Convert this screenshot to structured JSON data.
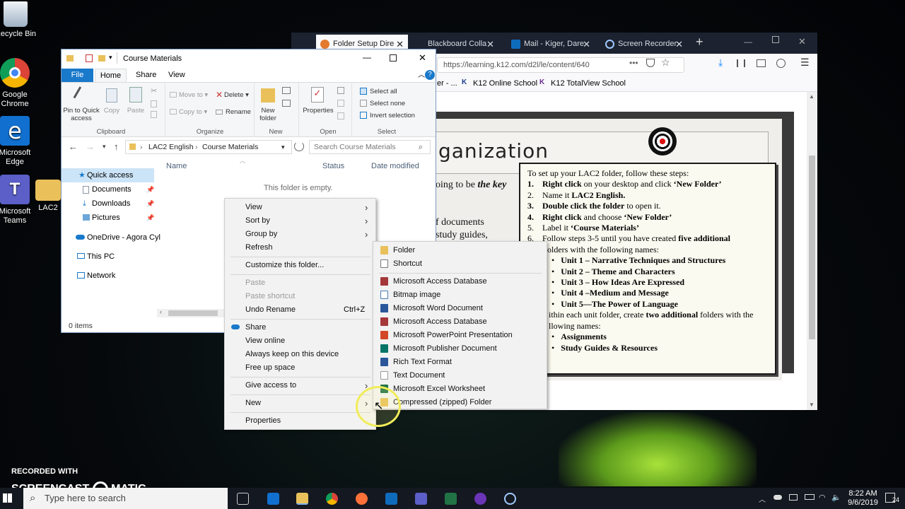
{
  "desktop": {
    "icons": [
      {
        "label": "Recycle Bin"
      },
      {
        "label": "Google Chrome"
      },
      {
        "label": "Microsoft Edge"
      },
      {
        "label": "Microsoft Teams"
      },
      {
        "label": "LAC2"
      }
    ]
  },
  "browser": {
    "tabs": [
      {
        "label": "Folder Setup Dire",
        "active": true
      },
      {
        "label": "Blackboard Colla"
      },
      {
        "label": "Mail - Kiger, Dare"
      },
      {
        "label": "Screen Recorder"
      }
    ],
    "url": "https://learning.k12.com/d2l/le/content/640",
    "bookmarks": [
      "er - ...",
      "K12 Online School",
      "K12 TotalView School"
    ],
    "slide": {
      "heading": "ganization",
      "text1": "oing to be",
      "text1_em": "the key",
      "text2": "f documents",
      "text3": "study guides,",
      "instructions": {
        "intro": "To set up your LAC2 folder, follow these steps:",
        "s1_num": "1.",
        "s1_bold": "Right click",
        "s1_rest": " on your desktop and click ",
        "s1_q": "‘New Folder’",
        "s2_num": "2.",
        "s2_text": "Name it ",
        "s2_bold": "LAC2 English.",
        "s3_num": "3.",
        "s3_bold": "Double click the folder",
        "s3_rest": " to open it.",
        "s4_num": "4.",
        "s4_bold": "Right click",
        "s4_rest": " and choose ",
        "s4_q": "‘New Folder’",
        "s5_num": "5.",
        "s5_text": "Label it ",
        "s5_bold": "‘Course Materials’",
        "s6_num": "6.",
        "s6_text": "Follow steps 3-5 until you have created ",
        "s6_bold": "five additional",
        "s6_cont": "folders with the following names:",
        "units": [
          "Unit 1 – Narrative Techniques and Structures",
          "Unit 2 – Theme and Characters",
          "Unit 3 – How Ideas Are Expressed",
          "Unit 4 –Medium and Message",
          "Unit 5—The Power of Language"
        ],
        "within_text": "ithin each unit folder, create ",
        "within_bold": "two additional",
        "within_rest": " folders with the",
        "within_cont": "llowing names:",
        "sub": [
          "Assignments",
          "Study Guides & Resources"
        ]
      }
    }
  },
  "explorer": {
    "title": "Course Materials",
    "tabs": [
      "File",
      "Home",
      "Share",
      "View"
    ],
    "ribbon": {
      "pin": "Pin to Quick access",
      "copy": "Copy",
      "paste": "Paste",
      "move_to": "Move to",
      "copy_to": "Copy to",
      "delete": "Delete",
      "rename": "Rename",
      "new_folder": "New folder",
      "properties": "Properties",
      "select_all": "Select all",
      "select_none": "Select none",
      "invert": "Invert selection",
      "groups": [
        "Clipboard",
        "Organize",
        "New",
        "Open",
        "Select"
      ]
    },
    "breadcrumb": [
      "LAC2 English",
      "Course Materials"
    ],
    "search_placeholder": "Search Course Materials",
    "columns": [
      "Name",
      "Status",
      "Date modified"
    ],
    "empty": "This folder is empty.",
    "nav": [
      "Quick access",
      "Documents",
      "Downloads",
      "Pictures",
      "OneDrive - Agora Cyl",
      "This PC",
      "Network"
    ],
    "status": "0 items"
  },
  "context_menu": {
    "items": {
      "view": "View",
      "sort_by": "Sort by",
      "group_by": "Group by",
      "refresh": "Refresh",
      "customize": "Customize this folder...",
      "paste": "Paste",
      "paste_shortcut": "Paste shortcut",
      "undo_rename": "Undo Rename",
      "undo_shortcut": "Ctrl+Z",
      "share": "Share",
      "view_online": "View online",
      "always_keep": "Always keep on this device",
      "free_up": "Free up space",
      "give_access": "Give access to",
      "new": "New",
      "properties": "Properties"
    },
    "new_submenu": [
      "Folder",
      "Shortcut",
      "Microsoft Access Database",
      "Bitmap image",
      "Microsoft Word Document",
      "Microsoft Access Database",
      "Microsoft PowerPoint Presentation",
      "Microsoft Publisher Document",
      "Rich Text Format",
      "Text Document",
      "Microsoft Excel Worksheet",
      "Compressed (zipped) Folder"
    ]
  },
  "taskbar": {
    "search_placeholder": "Type here to search",
    "time": "8:22 AM",
    "date": "9/6/2019",
    "notifications": "24"
  },
  "watermark": {
    "line1": "RECORDED WITH",
    "line2a": "SCREENCAST",
    "line2b": "MATIC"
  },
  "colors": {
    "accent": "#1979ca",
    "explorer_border": "#7a98c0",
    "taskbar": "#141820",
    "browser_tabbar": "#1c2230"
  }
}
